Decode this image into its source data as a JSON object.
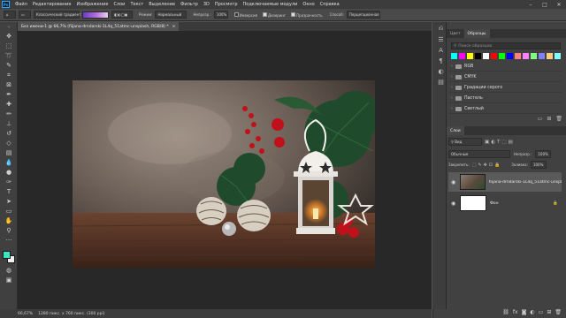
{
  "menubar": {
    "logo": "Ps",
    "items": [
      "Файл",
      "Редактирование",
      "Изображение",
      "Слои",
      "Текст",
      "Выделение",
      "Фильтр",
      "3D",
      "Просмотр",
      "Подключаемые модули",
      "Окно",
      "Справка"
    ]
  },
  "options": {
    "gradient_preset": "Классический градиент",
    "mode_label": "Режим:",
    "mode_value": "Нормальный",
    "opacity_label": "Непрозр.:",
    "opacity_value": "100%",
    "invert": "Инверсия",
    "dither": "Дизеринг",
    "transparency": "Прозрачность",
    "method_label": "Способ:",
    "method_value": "Перцепционная"
  },
  "document": {
    "tab_title": "Без имени-1 @ 66,7% (fiijana-drndarski-1L4q_51atmc-unsplash, RGB/8) *",
    "close_label": "×"
  },
  "swatches_panel": {
    "tabs": [
      "Цвет",
      "Образцы"
    ],
    "search_placeholder": "Поиск образцов",
    "colors": [
      "#00ffff",
      "#ff00ff",
      "#ffff00",
      "#000000",
      "#ffffff",
      "#ff0000",
      "#00ff00",
      "#0000ff",
      "#ff8080",
      "#ff80ff",
      "#80ff80",
      "#8080ff",
      "#ffcc80",
      "#80ffff"
    ],
    "folders": [
      "RGB",
      "CMYK",
      "Градации серого",
      "Пастель",
      "Светлый"
    ]
  },
  "layers_panel": {
    "tab": "Слои",
    "filter_label": "Вид",
    "blend_mode": "Обычные",
    "opacity_label": "Непрозр.:",
    "opacity_value": "100%",
    "lock_label": "Закрепить:",
    "fill_label": "Заливка:",
    "fill_value": "100%",
    "layers": [
      {
        "name": "fiijana-drndarski-1L4q_51atmc-unsplash",
        "selected": true
      },
      {
        "name": "Фон",
        "selected": false
      }
    ]
  },
  "status": {
    "zoom": "66,67%",
    "doc_info": "1280 пикс. x 760 пикс. (300 ppi)"
  },
  "colors": {
    "foreground": "#38e8c0",
    "background": "#f0f0f0",
    "accent": "#31a8ff"
  }
}
